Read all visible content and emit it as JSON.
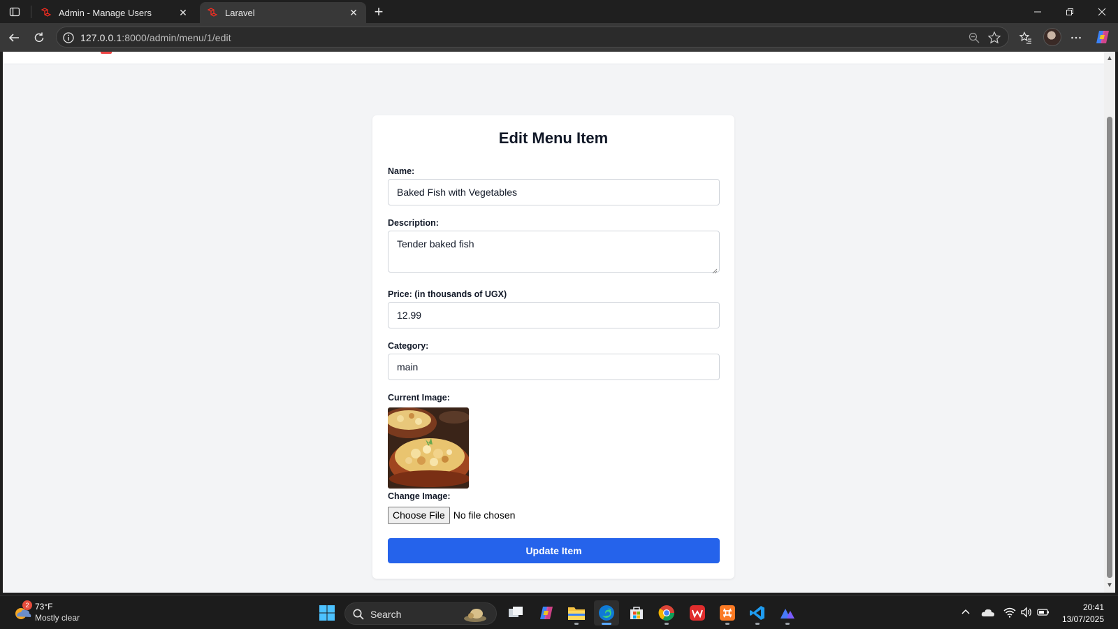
{
  "browser": {
    "tabs": [
      {
        "title": "Admin - Manage Users",
        "icon": "laravel-icon",
        "active": false
      },
      {
        "title": "Laravel",
        "icon": "laravel-icon",
        "active": true
      }
    ],
    "url_host": "127.0.0.1",
    "url_path": ":8000/admin/menu/1/edit"
  },
  "form": {
    "title": "Edit Menu Item",
    "name_label": "Name:",
    "name_value": "Baked Fish with Vegetables",
    "description_label": "Description:",
    "description_value": "Tender baked fish",
    "price_label": "Price: (in thousands of UGX)",
    "price_value": "12.99",
    "category_label": "Category:",
    "category_value": "main",
    "current_image_label": "Current Image:",
    "change_image_label": "Change Image:",
    "choose_file_label": "Choose File",
    "file_status": "No file chosen",
    "submit_label": "Update Item"
  },
  "taskbar": {
    "weather_badge": "2",
    "weather_temp": "73°F",
    "weather_desc": "Mostly clear",
    "search_label": "Search",
    "time": "20:41",
    "date": "13/07/2025",
    "apps": [
      "task-view-icon",
      "copilot-icon",
      "file-explorer-icon",
      "edge-icon",
      "microsoft-store-icon",
      "chrome-icon",
      "wps-office-icon",
      "xampp-icon",
      "vscode-icon",
      "photos-icon"
    ]
  },
  "colors": {
    "primary_button": "#2563eb",
    "page_background": "#f3f4f6",
    "laravel_red": "#ef4444"
  }
}
